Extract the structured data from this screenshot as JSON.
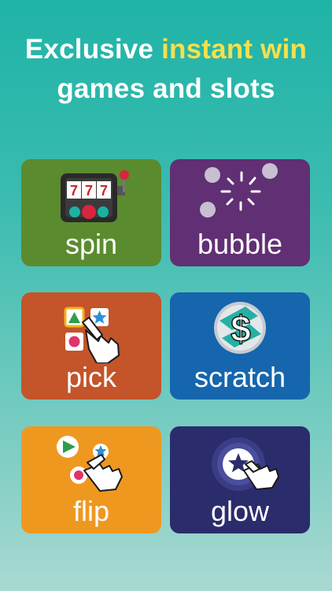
{
  "headline": {
    "line1_white": "Exclusive ",
    "line1_highlight": "instant win",
    "line2": "games and slots",
    "highlight_color": "#f4e04d"
  },
  "reels": [
    "7",
    "7",
    "7"
  ],
  "tiles": [
    {
      "label": "spin",
      "color": "#5b8b2f",
      "icon": "slot-machine-icon"
    },
    {
      "label": "bubble",
      "color": "#612f73",
      "icon": "bubble-pop-icon"
    },
    {
      "label": "pick",
      "color": "#c4542a",
      "icon": "pick-cards-hand-icon"
    },
    {
      "label": "scratch",
      "color": "#1566ad",
      "icon": "scratch-coin-icon"
    },
    {
      "label": "flip",
      "color": "#ef9820",
      "icon": "flip-shapes-hand-icon"
    },
    {
      "label": "glow",
      "color": "#2b2c6c",
      "icon": "glowing-star-hand-icon"
    }
  ]
}
